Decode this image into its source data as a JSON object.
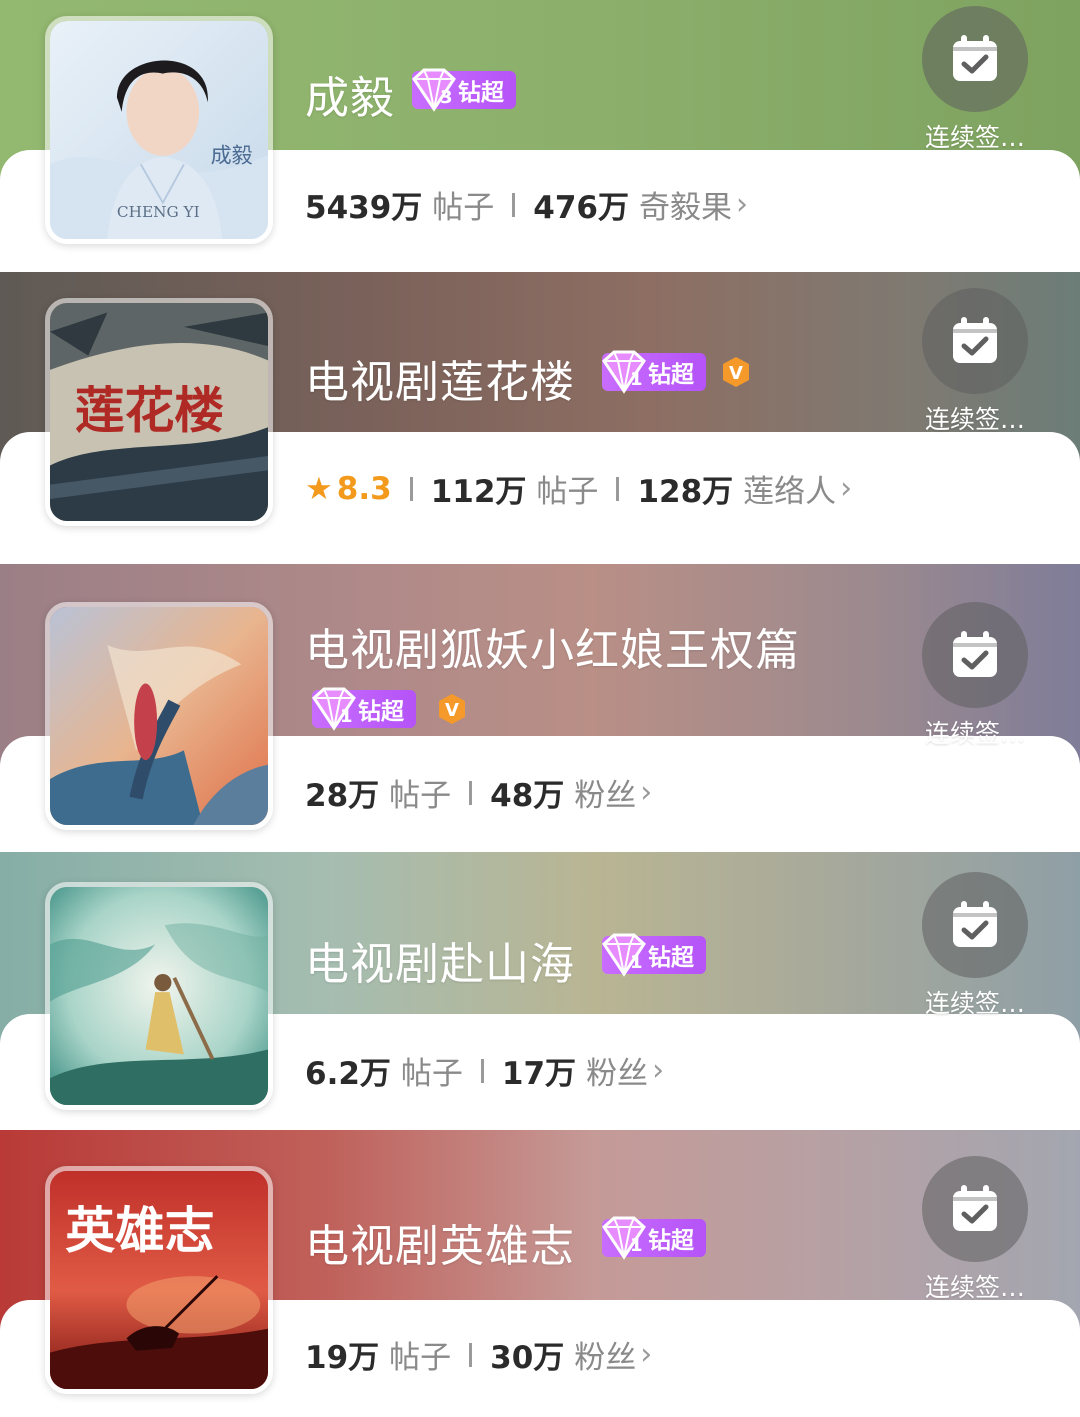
{
  "common": {
    "checkin_label": "连续签…",
    "badge_label": "钻超",
    "vip_mark": "V",
    "chevron": "›",
    "rating_star": "★"
  },
  "cards": [
    {
      "title": "成毅",
      "badge_level": "3",
      "posts_count": "5439万",
      "posts_label": "帖子",
      "fans_count": "476万",
      "fans_label": "奇毅果",
      "cover_text": "成毅",
      "cover_sub": "CHENG YI",
      "colors": {
        "banner": "#8fb26c"
      }
    },
    {
      "title": "电视剧莲花楼",
      "badge_level": "1",
      "rating": "8.3",
      "posts_count": "112万",
      "posts_label": "帖子",
      "fans_count": "128万",
      "fans_label": "莲络人",
      "cover_text": "莲花楼",
      "colors": {
        "banner": "#7e6a62"
      }
    },
    {
      "title": "电视剧狐妖小红娘王权篇",
      "badge_level": "1",
      "posts_count": "28万",
      "posts_label": "帖子",
      "fans_count": "48万",
      "fans_label": "粉丝",
      "colors": {
        "banner": "#a98587"
      }
    },
    {
      "title": "电视剧赴山海",
      "badge_level": "1",
      "posts_count": "6.2万",
      "posts_label": "帖子",
      "fans_count": "17万",
      "fans_label": "粉丝",
      "colors": {
        "banner": "#8fb0a6"
      }
    },
    {
      "title": "电视剧英雄志",
      "badge_level": "1",
      "posts_count": "19万",
      "posts_label": "帖子",
      "fans_count": "30万",
      "fans_label": "粉丝",
      "cover_text": "英雄志",
      "colors": {
        "banner": "#b94a45"
      }
    }
  ]
}
